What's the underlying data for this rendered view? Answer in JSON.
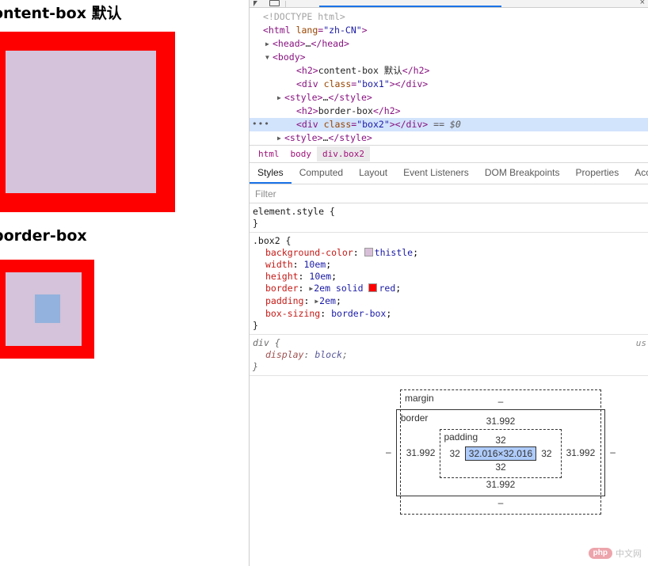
{
  "page": {
    "headings": {
      "content_box": "ontent-box 默认",
      "border_box": "border-box"
    },
    "colors": {
      "border_red": "#ff0000",
      "thistle": "#d4c3da",
      "content_highlight": "#93b2dd"
    }
  },
  "devtools": {
    "toolbar": {
      "inspect_icon": "inspect-cursor-icon",
      "device_icon": "device-toolbar-icon",
      "close_icon": "×"
    },
    "dom_tree": [
      {
        "indent": 0,
        "twisty": "",
        "html": "<span class=\"doctype\">&lt;!DOCTYPE html&gt;</span>",
        "selected": false
      },
      {
        "indent": 0,
        "twisty": "",
        "html": "<span class=\"tag\">&lt;html</span> <span class=\"attr-name\">lang</span>=<span class=\"attr-val\">\"zh-CN\"</span><span class=\"tag\">&gt;</span>",
        "selected": false
      },
      {
        "indent": 1,
        "twisty": "▶",
        "html": "<span class=\"tag\">&lt;head&gt;</span><span class=\"txt\">…</span><span class=\"tag\">&lt;/head&gt;</span>",
        "selected": false
      },
      {
        "indent": 1,
        "twisty": "▼",
        "html": "<span class=\"tag\">&lt;body&gt;</span>",
        "selected": false
      },
      {
        "indent": 3,
        "twisty": "",
        "html": "<span class=\"tag\">&lt;h2&gt;</span><span class=\"txt\">content-box 默认</span><span class=\"tag\">&lt;/h2&gt;</span>",
        "selected": false
      },
      {
        "indent": 3,
        "twisty": "",
        "html": "<span class=\"tag\">&lt;div</span> <span class=\"attr-name\">class</span>=<span class=\"attr-val\">\"box1\"</span><span class=\"tag\">&gt;&lt;/div&gt;</span>",
        "selected": false
      },
      {
        "indent": 2,
        "twisty": "▶",
        "html": "<span class=\"tag\">&lt;style&gt;</span><span class=\"txt\">…</span><span class=\"tag\">&lt;/style&gt;</span>",
        "selected": false
      },
      {
        "indent": 3,
        "twisty": "",
        "html": "<span class=\"tag\">&lt;h2&gt;</span><span class=\"txt\">border-box</span><span class=\"tag\">&lt;/h2&gt;</span>",
        "selected": false
      },
      {
        "indent": 3,
        "twisty": "",
        "html": "<span class=\"tag\">&lt;div</span> <span class=\"attr-name\">class</span>=<span class=\"attr-val\">\"box2\"</span><span class=\"tag\">&gt;&lt;/div&gt;</span> <span class=\"dollar\">== $0</span>",
        "selected": true
      },
      {
        "indent": 2,
        "twisty": "▶",
        "html": "<span class=\"tag\">&lt;style&gt;</span><span class=\"txt\">…</span><span class=\"tag\">&lt;/style&gt;</span>",
        "selected": false
      }
    ],
    "breadcrumb": [
      {
        "label": "html",
        "active": false
      },
      {
        "label": "body",
        "active": false
      },
      {
        "label": "div.box2",
        "active": true
      }
    ],
    "tabs": [
      {
        "label": "Styles",
        "active": true
      },
      {
        "label": "Computed",
        "active": false
      },
      {
        "label": "Layout",
        "active": false
      },
      {
        "label": "Event Listeners",
        "active": false
      },
      {
        "label": "DOM Breakpoints",
        "active": false
      },
      {
        "label": "Properties",
        "active": false
      },
      {
        "label": "Acces",
        "active": false
      }
    ],
    "filter": {
      "placeholder": "Filter",
      "value": ""
    },
    "rules": [
      {
        "selector": "element.style {",
        "close": "}",
        "ua": false,
        "source": "",
        "declarations": []
      },
      {
        "selector": ".box2 {",
        "close": "}",
        "ua": false,
        "source": "",
        "declarations": [
          {
            "prop": "background-color",
            "value": "thistle",
            "swatch": "#d8bfd8",
            "expand": false
          },
          {
            "prop": "width",
            "value": "10em",
            "swatch": "",
            "expand": false
          },
          {
            "prop": "height",
            "value": "10em",
            "swatch": "",
            "expand": false
          },
          {
            "prop": "border",
            "value": "2em solid red",
            "swatch": "#ff0000",
            "swatch_after": "2em solid ",
            "expand": true
          },
          {
            "prop": "padding",
            "value": "2em",
            "swatch": "",
            "expand": true
          },
          {
            "prop": "box-sizing",
            "value": "border-box",
            "swatch": "",
            "expand": false
          }
        ]
      },
      {
        "selector": "div {",
        "close": "}",
        "ua": true,
        "source": "us",
        "declarations": [
          {
            "prop": "display",
            "value": "block",
            "swatch": "",
            "expand": false
          }
        ]
      }
    ],
    "box_model": {
      "margin_label": "margin",
      "border_label": "border",
      "padding_label": "padding",
      "margin_top": "–",
      "margin_right": "–",
      "margin_bottom": "–",
      "margin_left": "–",
      "border_top": "31.992",
      "border_right": "31.992",
      "border_bottom": "31.992",
      "border_left": "31.992",
      "padding_top": "32",
      "padding_right": "32",
      "padding_bottom": "32",
      "padding_left": "32",
      "content": "32.016×32.016"
    }
  },
  "watermark": {
    "badge": "php",
    "text": "中文网"
  }
}
